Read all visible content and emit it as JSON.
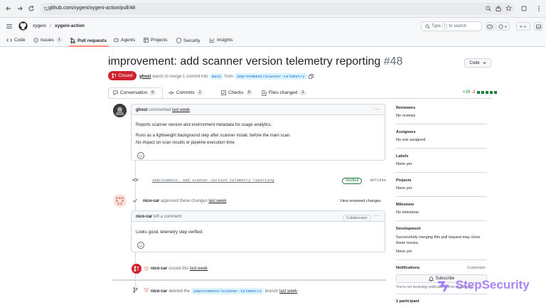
{
  "browser": {
    "url": "github.com/xygeni/xygeni-action/pull/48"
  },
  "header": {
    "owner": "xygeni",
    "separator": "/",
    "repo": "xygeni-action",
    "search_prefix": "Type",
    "search_key": "/",
    "search_suffix": "to search",
    "plus_label": "+"
  },
  "repo_tabs": [
    {
      "label": "Code"
    },
    {
      "label": "Issues",
      "count": "1"
    },
    {
      "label": "Pull requests"
    },
    {
      "label": "Agents"
    },
    {
      "label": "Projects"
    },
    {
      "label": "Security"
    },
    {
      "label": "Insights"
    }
  ],
  "pr": {
    "title": "improvement: add scanner version telemetry reporting",
    "number": "#48",
    "code_button": "Code",
    "state": "Closed",
    "author": "ghost",
    "meta_text": "wants to merge 1 commit into",
    "base_branch": "main",
    "from_text": "from",
    "head_branch": "improvement/scanner-telemetry"
  },
  "pr_tabs": [
    {
      "label": "Conversation",
      "count": "0"
    },
    {
      "label": "Commits",
      "count": "1"
    },
    {
      "label": "Checks",
      "count": "0"
    },
    {
      "label": "Files changed",
      "count": "1"
    }
  ],
  "diffstat": {
    "additions": "+28",
    "deletions": "-2"
  },
  "timeline": {
    "first_comment": {
      "author": "ghost",
      "action": "commented",
      "time": "last week",
      "line1": "Reports scanner version and environment metadata for usage analytics.",
      "line2": "Runs as a lightweight background step after scanner install, before the main scan.",
      "line3": "No impact on scan results or pipeline execution time."
    },
    "commit": {
      "message": "improvement: add scanner version telemetry reporting",
      "verified": "Verified",
      "sha": "4bf1d4e"
    },
    "review": {
      "author": "nico-car",
      "action": "approved these changes",
      "time": "last week",
      "view_link": "View reviewed changes"
    },
    "review_comment": {
      "author": "nico-car",
      "action": "left a comment",
      "role": "Collaborator",
      "body": "Looks good, telemetry step verified."
    },
    "closed_event": {
      "author": "nico-car",
      "action": "closed this",
      "time": "last week"
    },
    "deleted_event": {
      "author": "nico-car",
      "action": "deleted the",
      "branch": "improvement/scanner-telemetry",
      "suffix": "branch",
      "time": "last week"
    }
  },
  "sidebar": {
    "reviewers_title": "Reviewers",
    "reviewers_value": "No reviews",
    "assignees_title": "Assignees",
    "assignees_value": "No one assigned",
    "labels_title": "Labels",
    "labels_value": "None yet",
    "projects_title": "Projects",
    "projects_value": "None yet",
    "milestone_title": "Milestone",
    "milestone_value": "No milestone",
    "development_title": "Development",
    "development_line1": "Successfully merging this pull request may close",
    "development_line2": "these issues.",
    "development_value": "None yet",
    "notifications_title": "Notifications",
    "customize": "Customize",
    "subscribe": "Subscribe",
    "notif_text": "You're not receiving notifications from this thread.",
    "participants": "1 participant"
  },
  "watermark": "StepSecurity",
  "colors": {
    "closed": "#cf222e",
    "accent_underline": "#fd8c73",
    "link_blue": "#0969da",
    "green": "#1a7f37"
  }
}
